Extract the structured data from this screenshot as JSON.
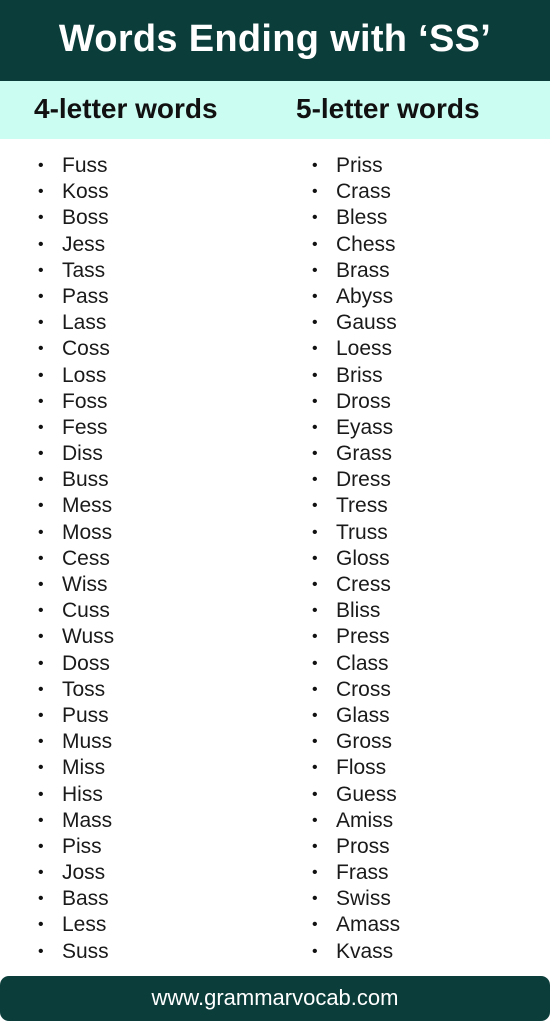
{
  "header": {
    "title": "Words Ending with ‘SS’"
  },
  "subheader": {
    "left_heading": "4-letter words",
    "right_heading": "5-letter words"
  },
  "lists": {
    "four_letter": [
      "Fuss",
      "Koss",
      "Boss",
      "Jess",
      "Tass",
      "Pass",
      "Lass",
      "Coss",
      "Loss",
      "Foss",
      "Fess",
      "Diss",
      "Buss",
      "Mess",
      "Moss",
      "Cess",
      "Wiss",
      "Cuss",
      "Wuss",
      "Doss",
      "Toss",
      "Puss",
      "Muss",
      "Miss",
      "Hiss",
      "Mass",
      "Piss",
      "Joss",
      "Bass",
      "Less",
      "Suss"
    ],
    "five_letter": [
      "Priss",
      "Crass",
      "Bless",
      "Chess",
      "Brass",
      "Abyss",
      "Gauss",
      "Loess",
      "Briss",
      "Dross",
      "Eyass",
      "Grass",
      "Dress",
      "Tress",
      "Truss",
      "Gloss",
      "Cress",
      "Bliss",
      "Press",
      "Class",
      "Cross",
      "Glass",
      "Gross",
      "Floss",
      "Guess",
      "Amiss",
      "Pross",
      "Frass",
      "Swiss",
      "Amass",
      "Kvass"
    ],
    "bullet_glyph": "•"
  },
  "footer": {
    "url": "www.grammarvocab.com"
  },
  "colors": {
    "header_bg": "#0b3d3a",
    "subheader_bg": "#ccfdf2",
    "footer_bg": "#0b3d3a"
  }
}
